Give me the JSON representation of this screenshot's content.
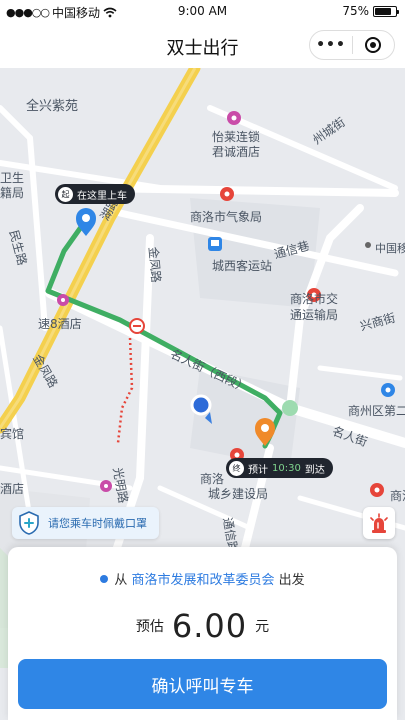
{
  "status_bar": {
    "carrier": "中国移动",
    "time": "9:00 AM",
    "battery": "75%",
    "battery_level": 0.75
  },
  "nav": {
    "title": "双士出行",
    "more_label": "•••"
  },
  "map": {
    "labels": {
      "quanxing": "全兴紫苑",
      "yilai": "怡莱连锁",
      "juncheng": "君诚酒店",
      "zhouchengjie": "州城街",
      "weishi": "卫生",
      "jiju": "籍局",
      "qixiangju": "商洛市气象局",
      "keyunzhan": "城西客运站",
      "tongxinxiang": "通信巷",
      "zhongguoyidong": "中国移动",
      "minsheng": "民生路",
      "jinfeng1": "金凤路",
      "jinfeng2": "金凤路",
      "jiaotong1": "商洛市交",
      "jiaotong2": "通运输局",
      "xingshang": "兴商街",
      "su8": "速8酒店",
      "mingren1": "名人街（西段）",
      "shangzhou": "商州区第二",
      "mingren2": "名人街",
      "binguan": "宾馆",
      "jiudian": "酒店",
      "chengxiang1": "商洛",
      "chengxiang2": "城乡建设局",
      "shangluo_r": "商洛",
      "tongxinlu": "通信路",
      "guangming": "光明路",
      "hukou": "湖路"
    },
    "pickup": {
      "tag": "起",
      "text": "在这里上车"
    },
    "destination": {
      "tag": "终",
      "prefix": "预计",
      "time": "10:30",
      "suffix": "到达"
    }
  },
  "notice": {
    "mask": "请您乘车时佩戴口罩"
  },
  "card": {
    "origin_prefix": "从",
    "origin_name": "商洛市发展和改革委员会",
    "origin_suffix": "出发",
    "price_prefix": "预估",
    "price_value": "6.00",
    "price_unit": "元",
    "confirm_label": "确认呼叫专车"
  },
  "colors": {
    "route": "#3fae63",
    "accent": "#2f86e6",
    "poi_red": "#e6453a",
    "poi_pink": "#c94ca8"
  }
}
